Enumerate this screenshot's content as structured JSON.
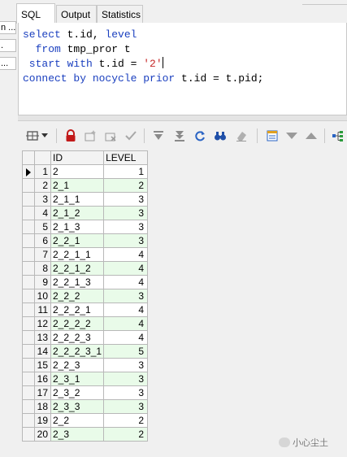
{
  "left_panel": {
    "items": [
      "n ...",
      ".",
      "..."
    ]
  },
  "tabs": [
    {
      "label": "SQL",
      "active": true
    },
    {
      "label": "Output",
      "active": false
    },
    {
      "label": "Statistics",
      "active": false
    }
  ],
  "editor": {
    "lines": [
      [
        {
          "t": "select",
          "c": "kw"
        },
        {
          "t": " t.id, ",
          "c": ""
        },
        {
          "t": "level",
          "c": "kw"
        }
      ],
      [
        {
          "t": "  from",
          "c": "kw"
        },
        {
          "t": " tmp_pror t",
          "c": ""
        }
      ],
      [
        {
          "t": " start with",
          "c": "kw"
        },
        {
          "t": " t.id = ",
          "c": ""
        },
        {
          "t": "'2'",
          "c": "str"
        }
      ],
      [
        {
          "t": "connect by nocycle prior",
          "c": "kw"
        },
        {
          "t": " t.id = t.pid;",
          "c": ""
        }
      ]
    ]
  },
  "toolbar": {
    "icons": [
      "grid-select-icon",
      "dropdown-arrow-icon",
      "lock-icon",
      "insert-record-icon",
      "delete-record-icon",
      "post-changes-icon",
      "fetch-next-page-icon",
      "fetch-last-page-icon",
      "refresh-icon",
      "find-icon",
      "clear-icon",
      "export-icon",
      "sort-desc-icon",
      "sort-asc-icon",
      "query-plan-icon"
    ]
  },
  "grid": {
    "columns": [
      "ID",
      "LEVEL"
    ],
    "rows": [
      {
        "n": "1",
        "id": "2",
        "level": "1"
      },
      {
        "n": "2",
        "id": "2_1",
        "level": "2"
      },
      {
        "n": "3",
        "id": "2_1_1",
        "level": "3"
      },
      {
        "n": "4",
        "id": "2_1_2",
        "level": "3"
      },
      {
        "n": "5",
        "id": "2_1_3",
        "level": "3"
      },
      {
        "n": "6",
        "id": "2_2_1",
        "level": "3"
      },
      {
        "n": "7",
        "id": "2_2_1_1",
        "level": "4"
      },
      {
        "n": "8",
        "id": "2_2_1_2",
        "level": "4"
      },
      {
        "n": "9",
        "id": "2_2_1_3",
        "level": "4"
      },
      {
        "n": "10",
        "id": "2_2_2",
        "level": "3"
      },
      {
        "n": "11",
        "id": "2_2_2_1",
        "level": "4"
      },
      {
        "n": "12",
        "id": "2_2_2_2",
        "level": "4"
      },
      {
        "n": "13",
        "id": "2_2_2_3",
        "level": "4"
      },
      {
        "n": "14",
        "id": "2_2_2_3_1",
        "level": "5"
      },
      {
        "n": "15",
        "id": "2_2_3",
        "level": "3"
      },
      {
        "n": "16",
        "id": "2_3_1",
        "level": "3"
      },
      {
        "n": "17",
        "id": "2_3_2",
        "level": "3"
      },
      {
        "n": "18",
        "id": "2_3_3",
        "level": "3"
      },
      {
        "n": "19",
        "id": "2_2",
        "level": "2"
      },
      {
        "n": "20",
        "id": "2_3",
        "level": "2"
      }
    ]
  },
  "watermark": {
    "text": "小心尘土"
  },
  "colors": {
    "keyword": "#1a3fbf",
    "string": "#c62828",
    "alt_row": "#e9fbe9"
  }
}
